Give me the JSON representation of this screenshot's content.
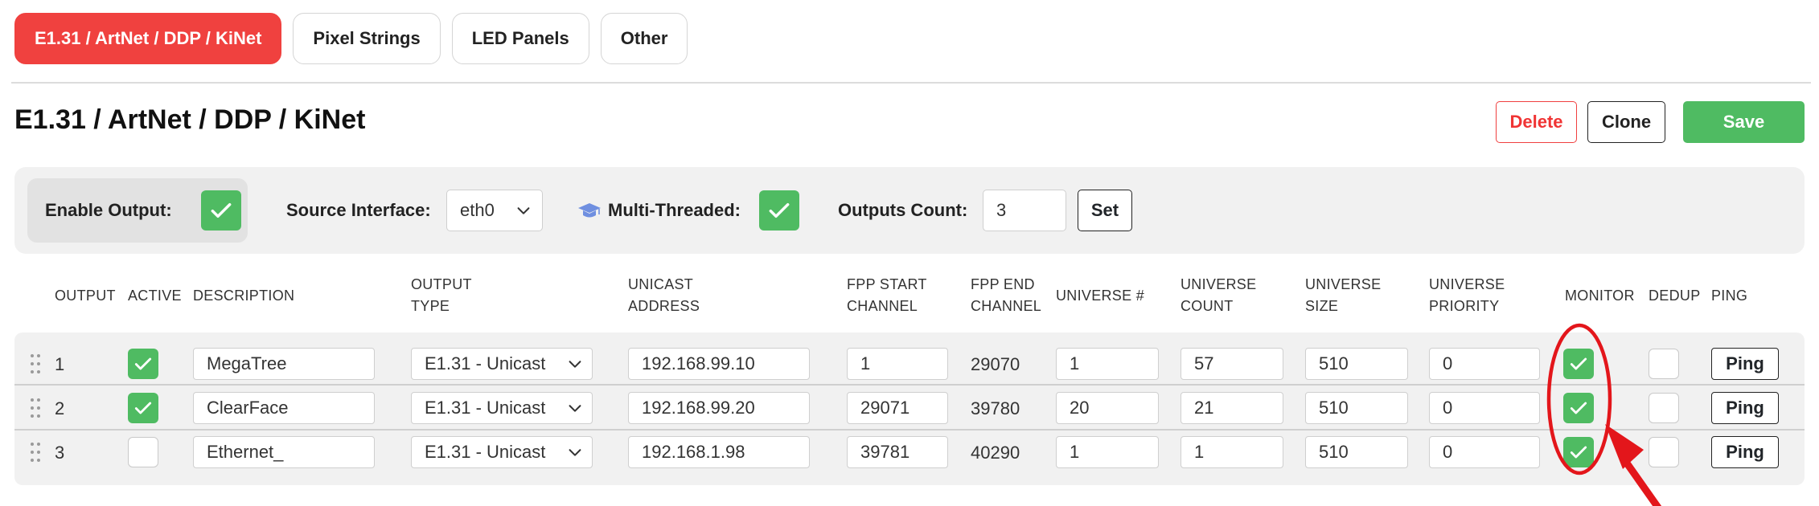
{
  "tabs": [
    {
      "label": "E1.31 / ArtNet / DDP / KiNet",
      "active": true
    },
    {
      "label": "Pixel Strings",
      "active": false
    },
    {
      "label": "LED Panels",
      "active": false
    },
    {
      "label": "Other",
      "active": false
    }
  ],
  "page_title": "E1.31 / ArtNet / DDP / KiNet",
  "actions": {
    "delete": "Delete",
    "clone": "Clone",
    "save": "Save"
  },
  "settings": {
    "enable_output_label": "Enable Output:",
    "enable_output_checked": true,
    "source_interface_label": "Source Interface:",
    "source_interface_value": "eth0",
    "multi_threaded_label": "Multi-Threaded:",
    "multi_threaded_checked": true,
    "outputs_count_label": "Outputs Count:",
    "outputs_count_value": "3",
    "set_label": "Set"
  },
  "table": {
    "headers": {
      "output": "OUTPUT",
      "active": "ACTIVE",
      "description": "DESCRIPTION",
      "output_type_1": "OUTPUT",
      "output_type_2": "TYPE",
      "unicast_1": "UNICAST",
      "unicast_2": "ADDRESS",
      "fpp_start_1": "FPP START",
      "fpp_start_2": "CHANNEL",
      "fpp_end_1": "FPP END",
      "fpp_end_2": "CHANNEL",
      "universe_num": "UNIVERSE #",
      "universe_count_1": "UNIVERSE",
      "universe_count_2": "COUNT",
      "universe_size_1": "UNIVERSE",
      "universe_size_2": "SIZE",
      "universe_priority_1": "UNIVERSE",
      "universe_priority_2": "PRIORITY",
      "monitor": "MONITOR",
      "dedup": "DEDUP",
      "ping": "PING"
    },
    "rows": [
      {
        "output": "1",
        "active": true,
        "description": "MegaTree",
        "type": "E1.31 - Unicast",
        "address": "192.168.99.10",
        "start": "1",
        "end": "29070",
        "universe": "1",
        "count": "57",
        "size": "510",
        "priority": "0",
        "monitor": true,
        "dedup": false,
        "ping": "Ping"
      },
      {
        "output": "2",
        "active": true,
        "description": "ClearFace",
        "type": "E1.31 - Unicast",
        "address": "192.168.99.20",
        "start": "29071",
        "end": "39780",
        "universe": "20",
        "count": "21",
        "size": "510",
        "priority": "0",
        "monitor": true,
        "dedup": false,
        "ping": "Ping"
      },
      {
        "output": "3",
        "active": false,
        "description": "Ethernet_",
        "type": "E1.31 - Unicast",
        "address": "192.168.1.98",
        "start": "39781",
        "end": "40290",
        "universe": "1",
        "count": "1",
        "size": "510",
        "priority": "0",
        "monitor": true,
        "dedup": false,
        "ping": "Ping"
      }
    ]
  },
  "colors": {
    "accent_red": "#f0413f",
    "check_green": "#4fbb62",
    "annotation_red": "#e3161b",
    "icon_blue": "#6f8fe0"
  }
}
